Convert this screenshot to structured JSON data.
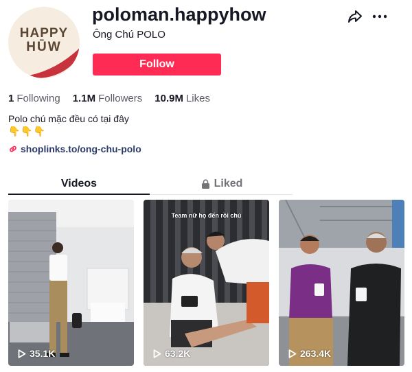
{
  "profile": {
    "avatar_line1": "HAPPY",
    "avatar_line2": "HŪW",
    "username": "poloman.happyhow",
    "nickname": "Ông Chú POLO",
    "follow_label": "Follow"
  },
  "stats": {
    "following_count": "1",
    "following_label": "Following",
    "followers_count": "1.1M",
    "followers_label": "Followers",
    "likes_count": "10.9M",
    "likes_label": "Likes"
  },
  "bio": {
    "text": "Polo chú mặc đều có tại đây",
    "emojis": "👇👇👇",
    "link": "shoplinks.to/ong-chu-polo"
  },
  "tabs": {
    "videos": "Videos",
    "liked": "Liked"
  },
  "videos": [
    {
      "views": "35.1K",
      "caption": ""
    },
    {
      "views": "63.2K",
      "caption": "Team nữ họ đến rồi chú"
    },
    {
      "views": "263.4K",
      "caption": ""
    }
  ],
  "colors": {
    "accent": "#fe2c55",
    "link": "#2b3a67",
    "text_secondary": "#5b5d66"
  },
  "icons": {
    "share": "share-icon",
    "more": "more-icon",
    "link": "link-icon",
    "lock": "lock-icon",
    "play": "play-icon"
  }
}
